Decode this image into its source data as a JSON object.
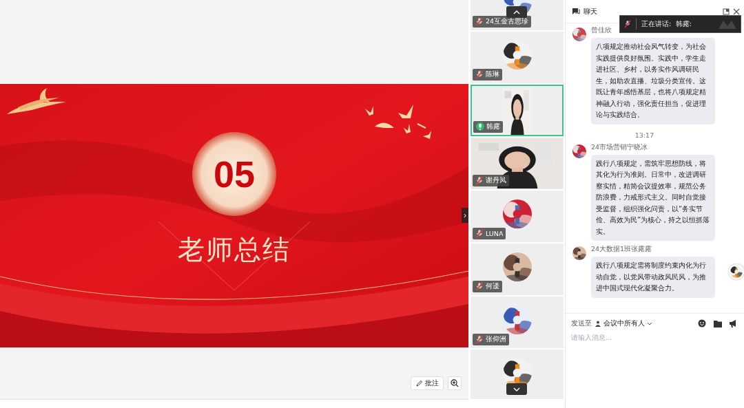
{
  "stage": {
    "slide": {
      "number": "05",
      "title": "老师总结"
    },
    "collapse_handle": "›",
    "annotate_button": "批注"
  },
  "participants": [
    {
      "name": "24互金古思珍",
      "kind": "avatar",
      "muted": true,
      "selected": false
    },
    {
      "name": "陈琳",
      "kind": "avatar",
      "muted": true,
      "selected": false
    },
    {
      "name": "韩露",
      "kind": "portrait_video",
      "muted": false,
      "selected": true
    },
    {
      "name": "谢丹凤",
      "kind": "video",
      "muted": true,
      "selected": false
    },
    {
      "name": "LUNA",
      "kind": "avatar",
      "muted": true,
      "selected": false
    },
    {
      "name": "何逶",
      "kind": "avatar",
      "muted": true,
      "selected": false
    },
    {
      "name": "张仰洲",
      "kind": "avatar",
      "muted": true,
      "selected": false
    },
    {
      "kind": "avatar",
      "selected": false
    }
  ],
  "chat": {
    "title": "聊天",
    "speaking_banner": "正在讲话:  韩露:",
    "messages": [
      {
        "kind": "message",
        "sender": "曾佳欣",
        "text": "八项规定推动社会风气转变，为社会实践提供良好氛围。实践中，学生走进社区、乡村，以务实作风调研民生，如助农直播、垃圾分类宣传。这既让青年感悟基层，也将八项规定精神融入行动，强化责任担当，促进理论与实践结合。"
      },
      {
        "kind": "time",
        "text": "13:17"
      },
      {
        "kind": "message",
        "sender": "24市场营销宁晓冰",
        "text": "践行八项规定，需筑牢思想防线，将其化为行为准则。日常中，改进调研察实情，精简会议提效率，规范公务防浪费，力戒形式主义。同时自觉接受监督，组织强化问责，以“务实节俭、高效为民”为核心，持之以恒抓落实。"
      },
      {
        "kind": "message",
        "sender": "24大数据1班张露露",
        "text": "践行八项规定需将制度约束内化为行动自觉，以党风带动政风民风，为推进中国式现代化凝聚合力。"
      }
    ],
    "send_to": {
      "label": "发送至",
      "target": "会议中所有人"
    },
    "input": {
      "placeholder": "请输入消息..."
    }
  }
}
